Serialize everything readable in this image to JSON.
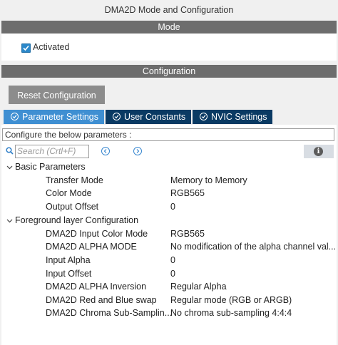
{
  "window": {
    "title": "DMA2D Mode and Configuration"
  },
  "mode": {
    "header": "Mode",
    "activated_label": "Activated",
    "activated_checked": true
  },
  "configuration": {
    "header": "Configuration",
    "reset_label": "Reset Configuration",
    "tabs": [
      {
        "label": "Parameter Settings",
        "active": true
      },
      {
        "label": "User Constants",
        "active": false
      },
      {
        "label": "NVIC Settings",
        "active": false
      }
    ],
    "hint": "Configure the below parameters :",
    "search_placeholder": "Search (Crtl+F)"
  },
  "groups": [
    {
      "name": "Basic Parameters",
      "params": [
        {
          "label": "Transfer Mode",
          "value": "Memory to Memory"
        },
        {
          "label": "Color Mode",
          "value": "RGB565"
        },
        {
          "label": "Output Offset",
          "value": "0"
        }
      ]
    },
    {
      "name": "Foreground layer Configuration",
      "params": [
        {
          "label": "DMA2D Input Color Mode",
          "value": "RGB565"
        },
        {
          "label": "DMA2D ALPHA MODE",
          "value": "No modification of the alpha channel val..."
        },
        {
          "label": "Input Alpha",
          "value": "0"
        },
        {
          "label": "Input Offset",
          "value": "0"
        },
        {
          "label": "DMA2D ALPHA Inversion",
          "value": "Regular Alpha"
        },
        {
          "label": "DMA2D Red and Blue swap",
          "value": "Regular mode (RGB or ARGB)"
        },
        {
          "label": "DMA2D Chroma Sub-Samplin...",
          "value": "No chroma sub-sampling 4:4:4"
        }
      ]
    }
  ],
  "colors": {
    "section_bar": "#6d6d6d",
    "tab_active": "#3f8fd2",
    "tab_inactive": "#0a3a63",
    "reset_button": "#8c8c8c"
  }
}
